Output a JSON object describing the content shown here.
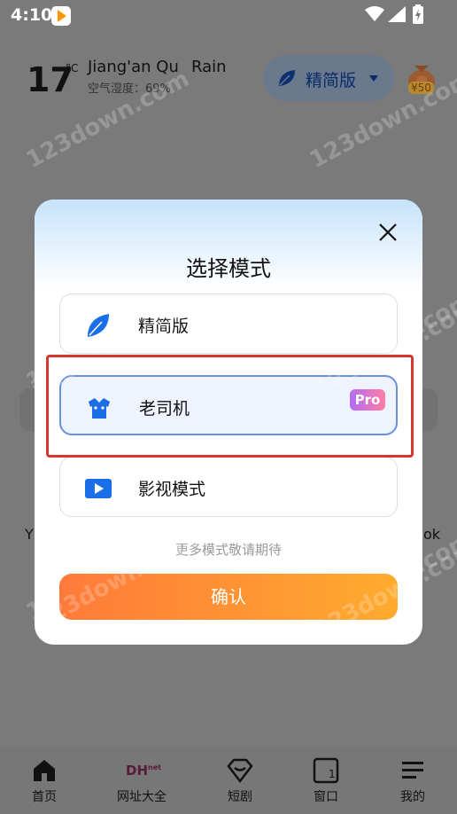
{
  "status_bar": {
    "time": "4:10"
  },
  "weather": {
    "temperature": "17",
    "unit": "°C",
    "location": "Jiang'an Qu",
    "condition": "Rain",
    "humidity": "空气湿度：69%"
  },
  "mode_pill": {
    "label": "精简版"
  },
  "red_packet": {
    "amount": "¥50"
  },
  "background_text": {
    "left": "Y",
    "right": "ok"
  },
  "dialog": {
    "title": "选择模式",
    "options": [
      {
        "label": "精简版",
        "icon": "leaf-icon",
        "selected": false
      },
      {
        "label": "老司机",
        "icon": "driver-icon",
        "selected": true,
        "badge": "Pro"
      },
      {
        "label": "影视模式",
        "icon": "video-play-icon",
        "selected": false
      }
    ],
    "hint": "更多模式敬请期待",
    "confirm_label": "确认"
  },
  "bottom_nav": [
    {
      "label": "首页",
      "icon": "home-icon"
    },
    {
      "label": "网址大全",
      "icon": "dh-net-icon",
      "icon_text": "DH",
      "icon_sup": "net"
    },
    {
      "label": "短剧",
      "icon": "drama-icon"
    },
    {
      "label": "窗口",
      "icon": "window-icon",
      "count": "1"
    },
    {
      "label": "我的",
      "icon": "menu-icon"
    }
  ],
  "watermark": "123down.com",
  "colors": {
    "accent_blue": "#1a6fe8",
    "selected_border": "#6b8fdf",
    "confirm_start": "#ff7a3a",
    "confirm_end": "#ffab2e",
    "highlight_red": "#d8352e"
  }
}
